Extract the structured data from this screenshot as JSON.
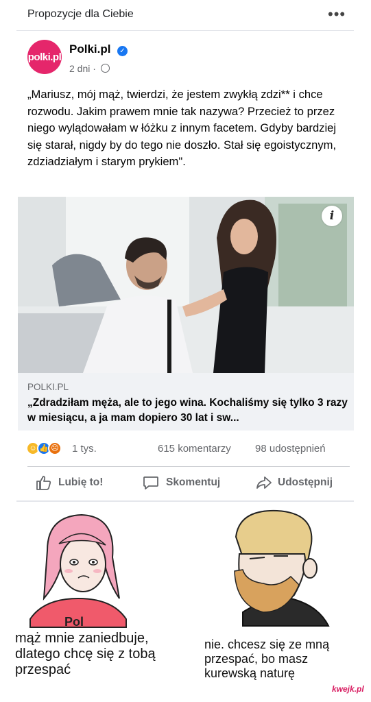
{
  "section": {
    "title": "Propozycje dla Ciebie",
    "more_icon": "more-dots-icon"
  },
  "post": {
    "avatar_text": "polki.pl",
    "page_name": "Polki.pl",
    "verified_icon": "verified-badge-icon",
    "time": "2 dni",
    "dot": "·",
    "privacy_icon": "globe-icon",
    "text": "„Mariusz, mój mąż, twierdzi, że jestem zwykłą zdzi** i chce rozwodu. Jakim prawem mnie tak nazywa? Przecież to przez niego wylądowałam w łóżku z innym facetem. Gdyby bardziej się starał, nigdy by do tego nie doszło. Stał się egoistycznym, zdziadziałym i starym prykiem\".",
    "info_icon_label": "i"
  },
  "link": {
    "domain": "POLKI.PL",
    "title": "„Zdradziłam męża, ale to jego wina. Kochaliśmy się tylko 3 razy w miesiącu, a ja mam dopiero 30 lat i sw..."
  },
  "stats": {
    "reactions_icons": [
      "haha-icon",
      "like-icon",
      "angry-icon"
    ],
    "reactions_count": "1 tys.",
    "comments": "615 komentarzy",
    "shares": "98 udostępnień"
  },
  "actions": {
    "like": "Lubię to!",
    "comment": "Skomentuj",
    "share": "Udostępnij"
  },
  "meme": {
    "left_caption": "mąż mnie zaniedbuje, dlatego chcę się z tobą przespać",
    "right_caption": "nie. chcesz się ze mną przespać, bo masz kurewską naturę",
    "shirt_text": "Pol",
    "watermark": "kwejk.pl"
  },
  "colors": {
    "brand": "#e5266b",
    "facebook_blue": "#1877f2",
    "muted": "#65676b"
  }
}
